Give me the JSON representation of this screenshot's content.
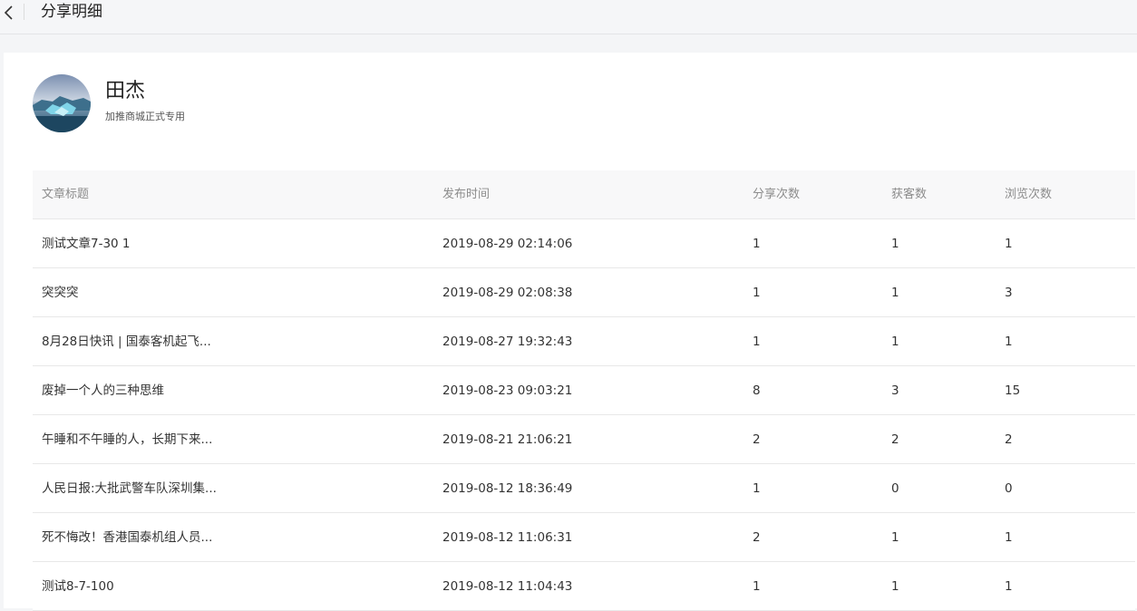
{
  "header": {
    "title": "分享明细"
  },
  "profile": {
    "name": "田杰",
    "subtitle": "加推商城正式专用"
  },
  "table": {
    "columns": [
      "文章标题",
      "发布时间",
      "分享次数",
      "获客数",
      "浏览次数"
    ],
    "rows": [
      {
        "title": "测试文章7-30 1",
        "time": "2019-08-29 02:14:06",
        "shares": "1",
        "customers": "1",
        "views": "1"
      },
      {
        "title": "突突突",
        "time": "2019-08-29 02:08:38",
        "shares": "1",
        "customers": "1",
        "views": "3"
      },
      {
        "title": "8月28日快讯 | 国泰客机起飞...",
        "time": "2019-08-27 19:32:43",
        "shares": "1",
        "customers": "1",
        "views": "1"
      },
      {
        "title": "废掉一个人的三种思维",
        "time": "2019-08-23 09:03:21",
        "shares": "8",
        "customers": "3",
        "views": "15"
      },
      {
        "title": "午睡和不午睡的人，长期下来...",
        "time": "2019-08-21 21:06:21",
        "shares": "2",
        "customers": "2",
        "views": "2"
      },
      {
        "title": "人民日报:大批武警车队深圳集...",
        "time": "2019-08-12 18:36:49",
        "shares": "1",
        "customers": "0",
        "views": "0"
      },
      {
        "title": "死不悔改！香港国泰机组人员...",
        "time": "2019-08-12 11:06:31",
        "shares": "2",
        "customers": "1",
        "views": "1"
      },
      {
        "title": "测试8-7-100",
        "time": "2019-08-12 11:04:43",
        "shares": "1",
        "customers": "1",
        "views": "1"
      }
    ]
  }
}
